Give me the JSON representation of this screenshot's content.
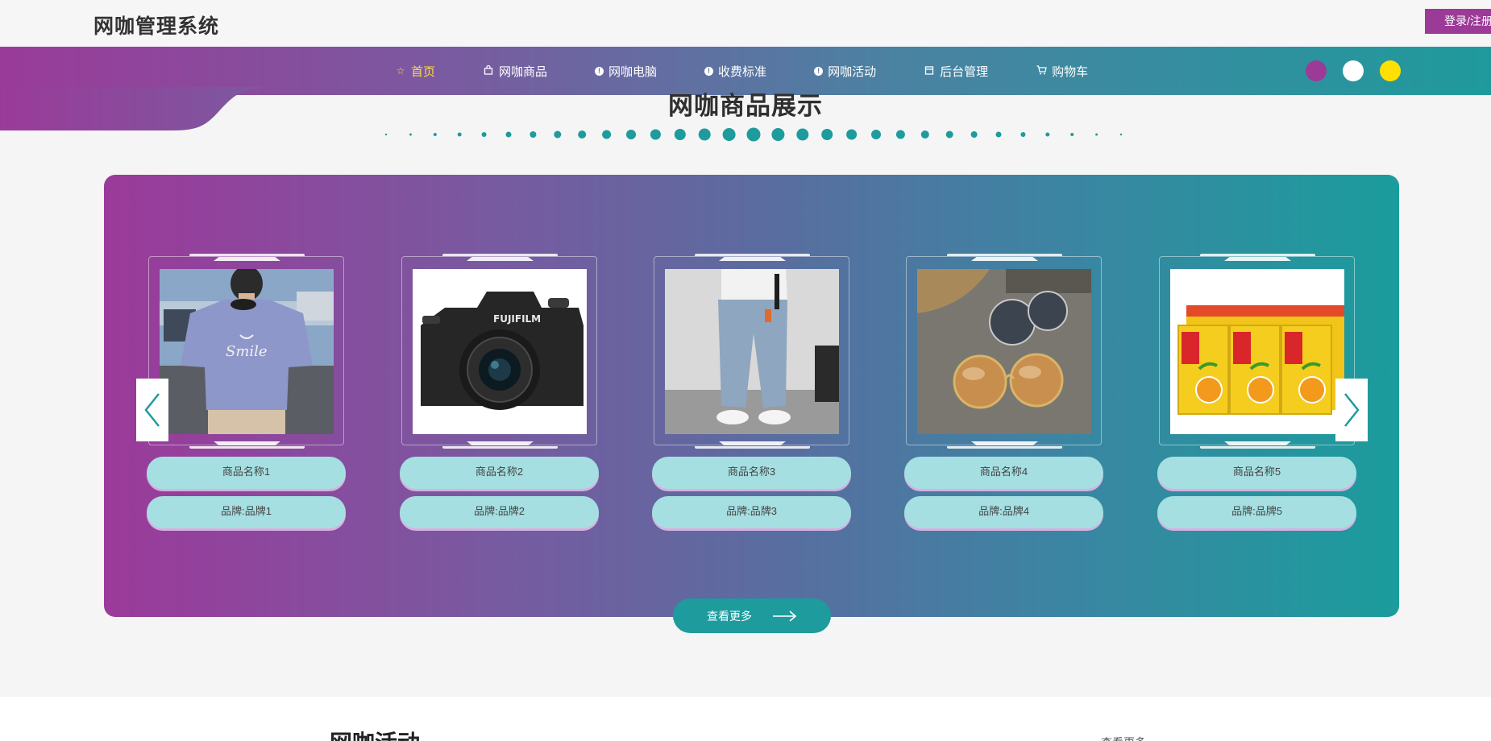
{
  "header": {
    "site_title": "网咖管理系统",
    "login_label": "登录/注册"
  },
  "nav": {
    "items": [
      {
        "label": "首页",
        "icon": "star-icon",
        "active": true
      },
      {
        "label": "网咖商品",
        "icon": "bag-icon",
        "active": false
      },
      {
        "label": "网咖电脑",
        "icon": "info-icon",
        "active": false
      },
      {
        "label": "收费标准",
        "icon": "info-icon",
        "active": false
      },
      {
        "label": "网咖活动",
        "icon": "info-icon",
        "active": false
      },
      {
        "label": "后台管理",
        "icon": "box-icon",
        "active": false
      },
      {
        "label": "购物车",
        "icon": "cart-icon",
        "active": false
      }
    ],
    "theme_colors": [
      "#9c3a98",
      "#ffffff",
      "#ffe000"
    ]
  },
  "products_section": {
    "title": "网咖商品展示",
    "more_label": "查看更多",
    "items": [
      {
        "name": "商品名称1",
        "brand": "品牌:品牌1",
        "image": "tshirt-photo"
      },
      {
        "name": "商品名称2",
        "brand": "品牌:品牌2",
        "image": "camera-photo"
      },
      {
        "name": "商品名称3",
        "brand": "品牌:品牌3",
        "image": "jeans-photo"
      },
      {
        "name": "商品名称4",
        "brand": "品牌:品牌4",
        "image": "sunglasses-photo"
      },
      {
        "name": "商品名称5",
        "brand": "品牌:品牌5",
        "image": "drink-photo"
      }
    ]
  },
  "activities_section": {
    "title": "网咖活动",
    "more_label": "查看更多»"
  },
  "colors": {
    "accent_purple": "#9c3a98",
    "accent_teal": "#1e9b9d",
    "active_nav": "#ffde3b",
    "pill": "#a5dfe2"
  }
}
